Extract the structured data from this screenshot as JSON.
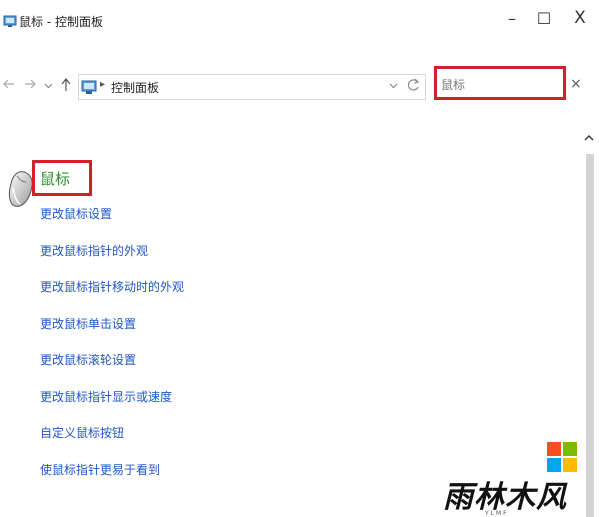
{
  "window": {
    "title": "鼠标 - 控制面板",
    "controls": {
      "minimize": "–",
      "maximize": "☐",
      "close": "X"
    }
  },
  "navigation": {
    "back_icon": "arrow-left-icon",
    "forward_icon": "arrow-right-icon",
    "recent_icon": "chevron-down-icon",
    "up_icon": "arrow-up-icon",
    "address": {
      "icon": "control-panel-icon",
      "separator": "▸",
      "path": "控制面板",
      "dropdown_icon": "chevron-down-icon",
      "refresh_icon": "refresh-icon"
    },
    "search": {
      "value": "鼠标",
      "clear_label": "×"
    }
  },
  "results": {
    "category_icon": "mouse-icon",
    "heading": "鼠标",
    "tasks": [
      "更改鼠标设置",
      "更改鼠标指针的外观",
      "更改鼠标指针移动时的外观",
      "更改鼠标单击设置",
      "更改鼠标滚轮设置",
      "更改鼠标指针显示或速度",
      "自定义鼠标按钮",
      "使鼠标指针更易于看到"
    ]
  },
  "watermark": {
    "logo_icon": "windows-flag-icon",
    "text": "雨林木风",
    "subtext": "YLMF"
  },
  "colors": {
    "highlight_border": "#d0202a",
    "heading_green": "#2e8b2e",
    "link_blue": "#1e56c8"
  }
}
